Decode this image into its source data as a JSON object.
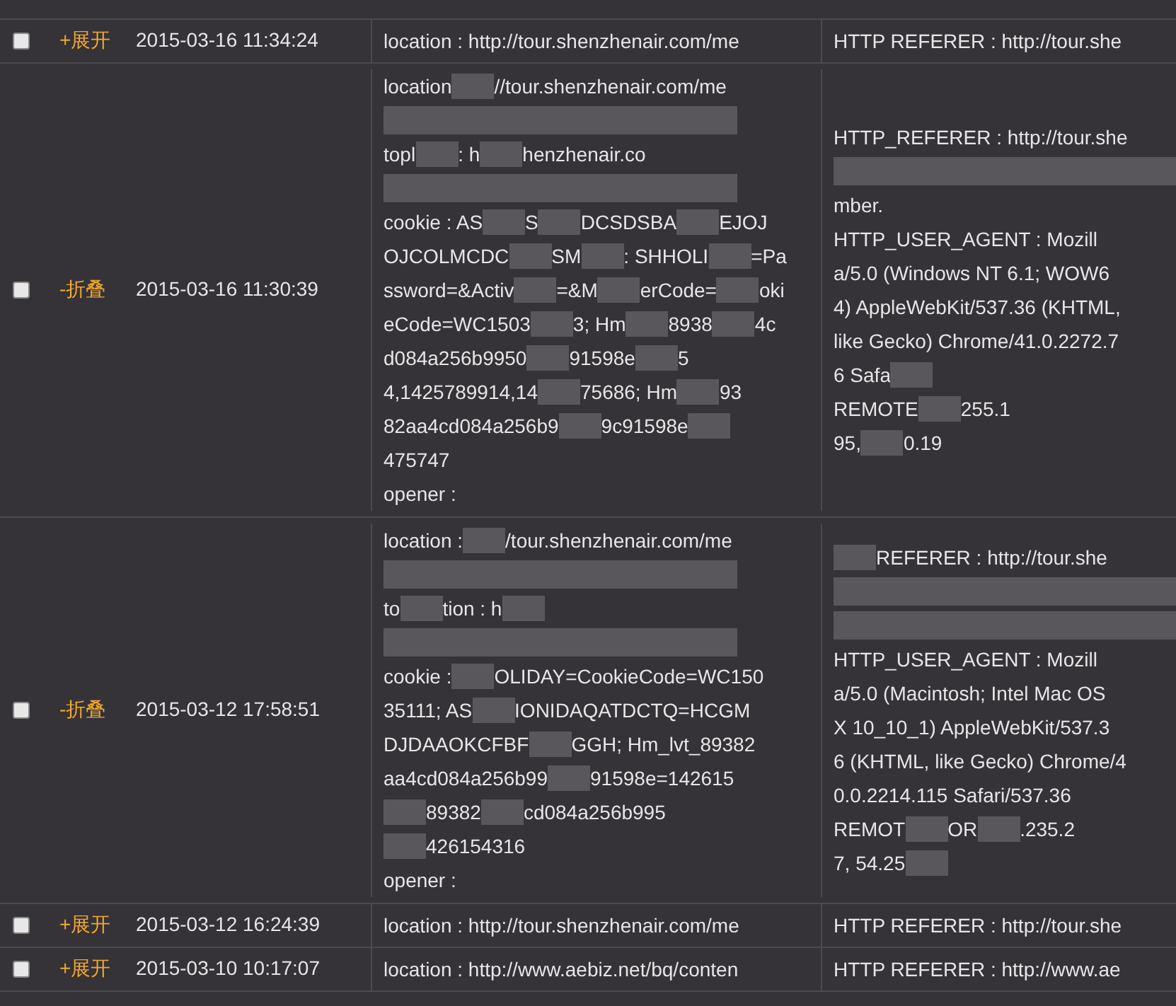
{
  "rows": [
    {
      "checked": false,
      "toggle": "+展开",
      "time": "2015-03-16 11:34:24",
      "location": [
        [
          "location : http://tour.shenzhenair.com/me"
        ]
      ],
      "referer": [
        [
          "HTTP REFERER : http://tour.she"
        ]
      ]
    },
    {
      "checked": false,
      "toggle": "-折叠",
      "time": "2015-03-16 11:30:39",
      "location": [
        [
          "location",
          {
            "kind": "redacted"
          },
          "//tour.shenzhenair.com/me"
        ],
        [
          {
            "kind": "redacted_line"
          }
        ],
        [
          "topl",
          {
            "kind": "redacted"
          },
          ": h",
          {
            "kind": "redacted"
          },
          "henzhenair.co"
        ],
        [
          {
            "kind": "redacted_line"
          }
        ],
        [
          "cookie : AS",
          {
            "kind": "redacted"
          },
          "S",
          {
            "kind": "redacted"
          },
          "DCSDSBA",
          {
            "kind": "redacted"
          },
          "EJOJ"
        ],
        [
          "OJCOLMCDC",
          {
            "kind": "redacted"
          },
          "SM",
          {
            "kind": "redacted"
          },
          ": SHHOLI",
          {
            "kind": "redacted"
          },
          "=Pa"
        ],
        [
          "ssword=&Activ",
          {
            "kind": "redacted"
          },
          "=&M",
          {
            "kind": "redacted"
          },
          "erCode=",
          {
            "kind": "redacted"
          },
          "oki"
        ],
        [
          "eCode=WC1503",
          {
            "kind": "redacted"
          },
          "3; Hm",
          {
            "kind": "redacted"
          },
          "8938",
          {
            "kind": "redacted"
          },
          "4c"
        ],
        [
          "d084a256b9950",
          {
            "kind": "redacted"
          },
          "91598e",
          {
            "kind": "redacted"
          },
          "5"
        ],
        [
          "4,1425789914,14",
          {
            "kind": "redacted"
          },
          "75686; Hm",
          {
            "kind": "redacted"
          },
          "93"
        ],
        [
          "82aa4cd084a256b9",
          {
            "kind": "redacted"
          },
          "9c91598e",
          {
            "kind": "redacted"
          }
        ],
        [
          "475747"
        ],
        [
          "opener :"
        ]
      ],
      "referer": [
        [
          "HTTP_REFERER : http://tour.she"
        ],
        [
          {
            "kind": "redacted_line"
          }
        ],
        [
          "mber."
        ],
        [
          "HTTP_USER_AGENT : Mozill"
        ],
        [
          "a/5.0 (Windows NT 6.1; WOW6"
        ],
        [
          "4) AppleWebKit/537.36 (KHTML,"
        ],
        [
          "like Gecko) Chrome/41.0.2272.7"
        ],
        [
          "6 Safa",
          {
            "kind": "redacted"
          }
        ],
        [
          "REMOTE",
          {
            "kind": "redacted"
          },
          "255.1"
        ],
        [
          "95,",
          {
            "kind": "redacted"
          },
          "0.19"
        ]
      ]
    },
    {
      "checked": false,
      "toggle": "-折叠",
      "time": "2015-03-12 17:58:51",
      "location": [
        [
          "location : ",
          {
            "kind": "redacted"
          },
          "/tour.shenzhenair.com/me"
        ],
        [
          {
            "kind": "redacted_line"
          }
        ],
        [
          "to",
          {
            "kind": "redacted"
          },
          "tion : h",
          {
            "kind": "redacted"
          }
        ],
        [
          {
            "kind": "redacted_line"
          }
        ],
        [
          "cookie : ",
          {
            "kind": "redacted"
          },
          "OLIDAY=CookieCode=WC150"
        ],
        [
          "35111; AS",
          {
            "kind": "redacted"
          },
          "IONIDAQATDCTQ=HCGM"
        ],
        [
          "DJDAAOKCFBF",
          {
            "kind": "redacted"
          },
          "GGH; Hm_lvt_89382"
        ],
        [
          "aa4cd084a256b99",
          {
            "kind": "redacted"
          },
          "91598e=142615"
        ],
        [
          {
            "kind": "redacted"
          },
          "89382",
          {
            "kind": "redacted"
          },
          "cd084a256b995"
        ],
        [
          {
            "kind": "redacted"
          },
          "426154316"
        ],
        [
          "opener :"
        ]
      ],
      "referer": [
        [
          {
            "kind": "redacted"
          },
          "REFERER : http://tour.she"
        ],
        [
          {
            "kind": "redacted_line"
          }
        ],
        [
          {
            "kind": "redacted_line"
          }
        ],
        [
          "HTTP_USER_AGENT : Mozill"
        ],
        [
          "a/5.0 (Macintosh; Intel Mac OS"
        ],
        [
          "X 10_10_1) AppleWebKit/537.3"
        ],
        [
          "6 (KHTML, like Gecko) Chrome/4"
        ],
        [
          "0.0.2214.115 Safari/537.36"
        ],
        [
          "REMOT",
          {
            "kind": "redacted"
          },
          "OR",
          {
            "kind": "redacted"
          },
          ".235.2"
        ],
        [
          "7, 54.25",
          {
            "kind": "redacted"
          }
        ]
      ]
    },
    {
      "checked": false,
      "toggle": "+展开",
      "time": "2015-03-12 16:24:39",
      "location": [
        [
          "location : http://tour.shenzhenair.com/me"
        ]
      ],
      "referer": [
        [
          "HTTP REFERER : http://tour.she"
        ]
      ]
    },
    {
      "checked": false,
      "toggle": "+展开",
      "time": "2015-03-10 10:17:07",
      "location": [
        [
          "location : http://www.aebiz.net/bq/conten"
        ]
      ],
      "referer": [
        [
          "HTTP REFERER : http://www.ae"
        ]
      ]
    }
  ]
}
